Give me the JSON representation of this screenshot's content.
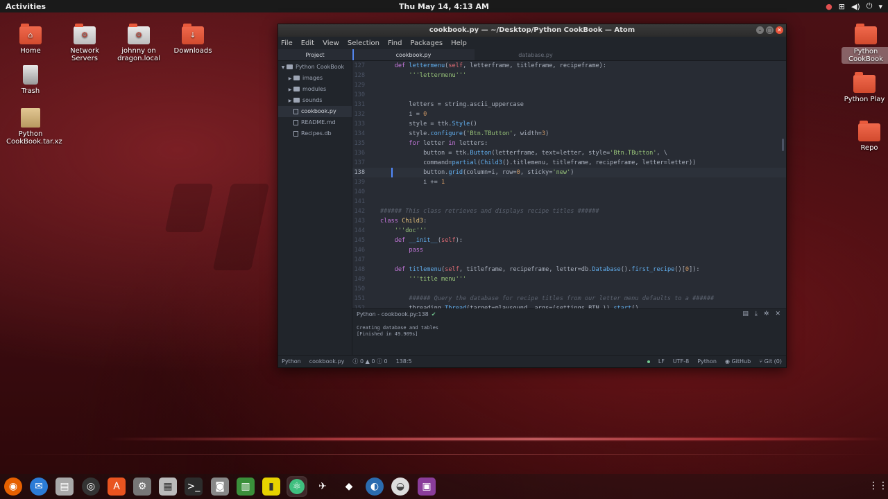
{
  "topbar": {
    "activities": "Activities",
    "clock": "Thu May 14,  4:13 AM"
  },
  "desktop_left": [
    {
      "label": "Home",
      "icon": "home-folder-icon"
    },
    {
      "label": "Network Servers",
      "icon": "network-servers-icon"
    },
    {
      "label": "johnny on dragon.local",
      "icon": "network-share-icon"
    },
    {
      "label": "Downloads",
      "icon": "downloads-folder-icon"
    },
    {
      "label": "Trash",
      "icon": "trash-icon"
    },
    {
      "label": "Python CookBook.tar.xz",
      "icon": "archive-icon"
    }
  ],
  "desktop_right": [
    {
      "label": "Python CookBook",
      "icon": "folder-icon"
    },
    {
      "label": "Python Play",
      "icon": "folder-icon"
    },
    {
      "label": "Repo",
      "icon": "folder-icon"
    }
  ],
  "window": {
    "title": "cookbook.py — ~/Desktop/Python CookBook — Atom",
    "menu": [
      "File",
      "Edit",
      "View",
      "Selection",
      "Find",
      "Packages",
      "Help"
    ]
  },
  "tree": {
    "header": "Project",
    "root": "Python CookBook",
    "items": [
      "images",
      "modules",
      "sounds",
      "cookbook.py",
      "README.md",
      "Recipes.db"
    ]
  },
  "tabs": [
    "cookbook.py",
    "database.py"
  ],
  "code": {
    "lines": [
      {
        "n": "127",
        "t": "    def lettermenu(self, letterframe, titleframe, recipeframe):"
      },
      {
        "n": "128",
        "t": "        '''lettermenu'''"
      },
      {
        "n": "129",
        "t": ""
      },
      {
        "n": "130",
        "t": ""
      },
      {
        "n": "131",
        "t": "        letters = string.ascii_uppercase"
      },
      {
        "n": "132",
        "t": "        i = 0"
      },
      {
        "n": "133",
        "t": "        style = ttk.Style()"
      },
      {
        "n": "134",
        "t": "        style.configure('Btn.TButton', width=3)"
      },
      {
        "n": "135",
        "t": "        for letter in letters:"
      },
      {
        "n": "136",
        "t": "            button = ttk.Button(letterframe, text=letter, style='Btn.TButton', \\"
      },
      {
        "n": "137",
        "t": "            command=partial(Child3().titlemenu, titleframe, recipeframe, letter=letter))"
      },
      {
        "n": "138",
        "t": "            button.grid(column=i, row=0, sticky='new')"
      },
      {
        "n": "139",
        "t": "            i += 1"
      },
      {
        "n": "140",
        "t": ""
      },
      {
        "n": "141",
        "t": ""
      },
      {
        "n": "142",
        "t": "###### This class retrieves and displays recipe titles ######"
      },
      {
        "n": "143",
        "t": "class Child3:"
      },
      {
        "n": "144",
        "t": "    '''doc'''"
      },
      {
        "n": "145",
        "t": "    def __init__(self):"
      },
      {
        "n": "146",
        "t": "        pass"
      },
      {
        "n": "147",
        "t": ""
      },
      {
        "n": "148",
        "t": "    def titlemenu(self, titleframe, recipeframe, letter=db.Database().first_recipe()[0]):"
      },
      {
        "n": "149",
        "t": "        '''title menu'''"
      },
      {
        "n": "150",
        "t": ""
      },
      {
        "n": "151",
        "t": "        ###### Query the database for recipe titles from our letter menu defaults to a ######"
      },
      {
        "n": "152",
        "t": "        threading.Thread(target=playsound, args=(settings.BTN,)).start()"
      }
    ],
    "cursor_line": "138"
  },
  "panel": {
    "title": "Python - cookbook.py:138",
    "output": [
      "Creating database and tables",
      "[Finished in 49.909s]"
    ]
  },
  "statusbar": {
    "grammar_left": "Python",
    "file": "cookbook.py",
    "errors": "0",
    "warnings": "0",
    "infos": "0",
    "position": "138:5",
    "line_ending": "LF",
    "encoding": "UTF-8",
    "grammar": "Python",
    "github": "GitHub",
    "git": "Git (0)"
  },
  "colors": {
    "keyword": "#c678dd",
    "function": "#61afef",
    "string": "#98c379",
    "comment": "#5c6370",
    "number": "#d19a66",
    "builtin": "#e06c75",
    "accent": "#568af2"
  }
}
